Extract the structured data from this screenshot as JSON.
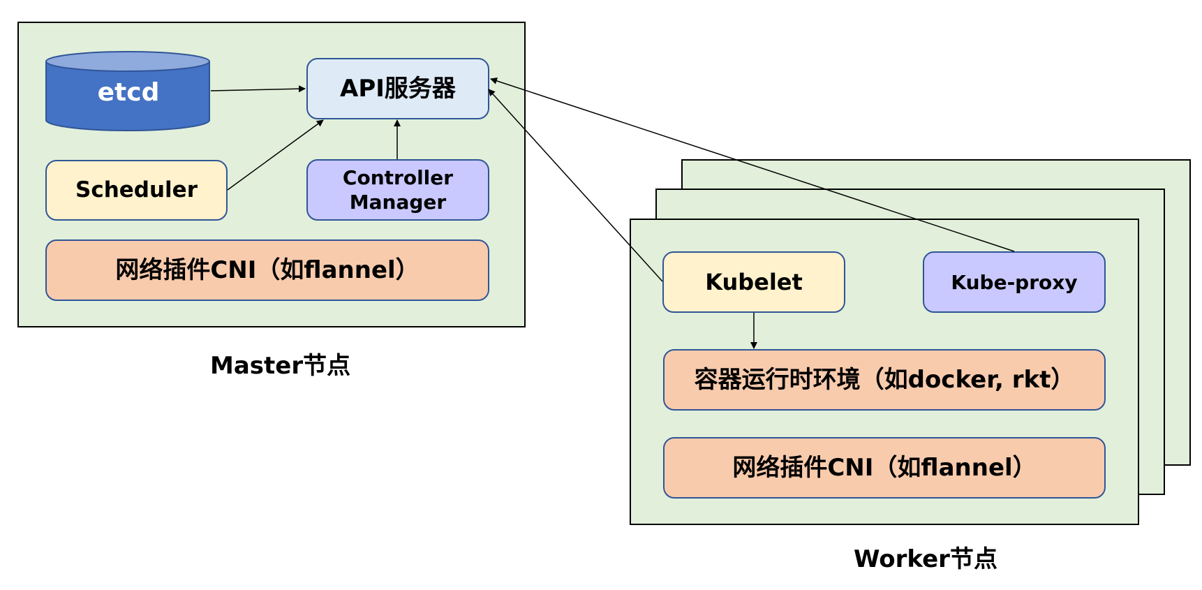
{
  "master": {
    "etcd": "etcd",
    "api_server": "API服务器",
    "scheduler": "Scheduler",
    "controller_manager": "Controller Manager",
    "cni": "网络插件CNI（如flannel）",
    "caption": "Master节点"
  },
  "worker": {
    "kubelet": "Kubelet",
    "kube_proxy": "Kube-proxy",
    "runtime": "容器运行时环境（如docker, rkt）",
    "cni": "网络插件CNI（如flannel）",
    "caption": "Worker节点"
  },
  "colors": {
    "panel_fill": "#e2efda",
    "etcd_fill": "#4472c4",
    "api_fill": "#deebf7",
    "yellow_fill": "#fff2cc",
    "purple_fill": "#c9c9ff",
    "orange_fill": "#f8cbad",
    "box_border": "#2f5597"
  }
}
